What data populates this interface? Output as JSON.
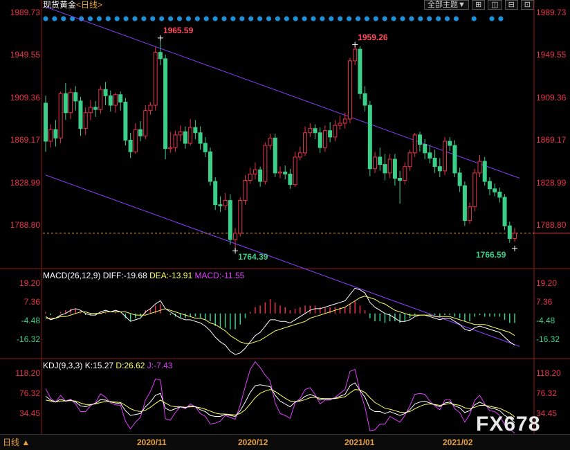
{
  "header": {
    "title": "现货黄金",
    "period_label": "<日线>"
  },
  "toolbar": {
    "theme_label": "全部主题▼",
    "btn1": "⊞",
    "btn2": "◫",
    "btn3": "⊟",
    "btn4": "⊡"
  },
  "price_axis": [
    "1989.73",
    "1949.55",
    "1909.36",
    "1869.17",
    "1828.99",
    "1788.80"
  ],
  "annotations": {
    "high1": "1965.59",
    "low1": "1764.39",
    "high2": "1959.26",
    "low2": "1766.59"
  },
  "macd": {
    "title": "MACD(26,12,9)",
    "diff_label": "DIFF:-19.68",
    "dea_label": "DEA:-13.91",
    "macd_label": "MACD:-11.55",
    "axis": [
      "19.20",
      "7.36",
      "-4.48",
      "-16.32"
    ]
  },
  "kdj": {
    "title": "KDJ(9,3,3)",
    "k_label": "K:15.27",
    "d_label": "D:26.62",
    "j_label": "J:-7.43",
    "axis": [
      "118.20",
      "76.32",
      "34.45"
    ]
  },
  "date_axis": [
    "2020/11",
    "2020/12",
    "2021/01",
    "2021/02"
  ],
  "bottom": {
    "period_button": "日线 ▲"
  },
  "watermark": "FX678",
  "colors": {
    "up": "#e8334a",
    "down": "#3ccf8a",
    "channel": "#8a3cff",
    "diff": "#ffffff",
    "dea": "#ffff66",
    "j": "#e040fb"
  },
  "chart_data": {
    "type": "candlestick",
    "instrument": "现货黄金",
    "y_range": [
      1764.39,
      1989.73
    ],
    "x_ticks": [
      "2020/11",
      "2020/12",
      "2021/01",
      "2021/02"
    ],
    "annotations": [
      {
        "label": "1965.59",
        "value": 1965.59
      },
      {
        "label": "1764.39",
        "value": 1764.39
      },
      {
        "label": "1959.26",
        "value": 1959.26
      },
      {
        "label": "1766.59",
        "value": 1766.59
      }
    ],
    "candles": [
      [
        1904,
        1868,
        1911,
        1858
      ],
      [
        1868,
        1879,
        1884,
        1862
      ],
      [
        1879,
        1871,
        1888,
        1863
      ],
      [
        1871,
        1913,
        1915,
        1866
      ],
      [
        1913,
        1895,
        1923,
        1888
      ],
      [
        1895,
        1914,
        1918,
        1889
      ],
      [
        1914,
        1906,
        1920,
        1897
      ],
      [
        1906,
        1880,
        1910,
        1873
      ],
      [
        1880,
        1895,
        1900,
        1874
      ],
      [
        1895,
        1900,
        1907,
        1888
      ],
      [
        1900,
        1898,
        1906,
        1891
      ],
      [
        1898,
        1917,
        1920,
        1894
      ],
      [
        1917,
        1911,
        1924,
        1902
      ],
      [
        1911,
        1902,
        1916,
        1896
      ],
      [
        1902,
        1912,
        1914,
        1895
      ],
      [
        1912,
        1905,
        1915,
        1897
      ],
      [
        1905,
        1869,
        1909,
        1864
      ],
      [
        1869,
        1858,
        1876,
        1852
      ],
      [
        1858,
        1879,
        1885,
        1856
      ],
      [
        1879,
        1873,
        1887,
        1868
      ],
      [
        1873,
        1897,
        1902,
        1870
      ],
      [
        1897,
        1902,
        1905,
        1893
      ],
      [
        1902,
        1952,
        1957,
        1897
      ],
      [
        1952,
        1946,
        1966,
        1940
      ],
      [
        1946,
        1861,
        1950,
        1851
      ],
      [
        1861,
        1862,
        1877,
        1857
      ],
      [
        1862,
        1874,
        1878,
        1858
      ],
      [
        1874,
        1877,
        1883,
        1868
      ],
      [
        1877,
        1866,
        1882,
        1861
      ],
      [
        1866,
        1881,
        1889,
        1864
      ],
      [
        1881,
        1876,
        1888,
        1870
      ],
      [
        1876,
        1866,
        1882,
        1860
      ],
      [
        1866,
        1858,
        1872,
        1853
      ],
      [
        1858,
        1830,
        1862,
        1826
      ],
      [
        1830,
        1808,
        1834,
        1803
      ],
      [
        1808,
        1807,
        1816,
        1801
      ],
      [
        1807,
        1812,
        1819,
        1803
      ],
      [
        1812,
        1775,
        1818,
        1770
      ],
      [
        1775,
        1781,
        1786,
        1764
      ],
      [
        1781,
        1812,
        1815,
        1778
      ],
      [
        1812,
        1831,
        1836,
        1808
      ],
      [
        1831,
        1837,
        1843,
        1828
      ],
      [
        1837,
        1841,
        1848,
        1832
      ],
      [
        1841,
        1830,
        1844,
        1825
      ],
      [
        1830,
        1864,
        1867,
        1827
      ],
      [
        1864,
        1871,
        1875,
        1860
      ],
      [
        1871,
        1838,
        1875,
        1834
      ],
      [
        1838,
        1839,
        1844,
        1833
      ],
      [
        1839,
        1837,
        1845,
        1832
      ],
      [
        1837,
        1827,
        1842,
        1823
      ],
      [
        1827,
        1853,
        1858,
        1825
      ],
      [
        1853,
        1857,
        1863,
        1850
      ],
      [
        1857,
        1876,
        1882,
        1854
      ],
      [
        1876,
        1880,
        1885,
        1872
      ],
      [
        1880,
        1876,
        1884,
        1870
      ],
      [
        1876,
        1862,
        1881,
        1857
      ],
      [
        1862,
        1878,
        1883,
        1858
      ],
      [
        1878,
        1872,
        1886,
        1867
      ],
      [
        1872,
        1883,
        1888,
        1868
      ],
      [
        1883,
        1885,
        1892,
        1879
      ],
      [
        1885,
        1889,
        1895,
        1880
      ],
      [
        1889,
        1944,
        1947,
        1885
      ],
      [
        1944,
        1955,
        1959,
        1940
      ],
      [
        1955,
        1913,
        1958,
        1908
      ],
      [
        1913,
        1902,
        1920,
        1896
      ],
      [
        1902,
        1842,
        1906,
        1835
      ],
      [
        1842,
        1853,
        1858,
        1838
      ],
      [
        1853,
        1846,
        1862,
        1840
      ],
      [
        1846,
        1838,
        1856,
        1831
      ],
      [
        1838,
        1851,
        1856,
        1833
      ],
      [
        1851,
        1833,
        1856,
        1826
      ],
      [
        1833,
        1831,
        1840,
        1809
      ],
      [
        1831,
        1844,
        1848,
        1827
      ],
      [
        1844,
        1857,
        1860,
        1840
      ],
      [
        1857,
        1874,
        1876,
        1853
      ],
      [
        1874,
        1865,
        1877,
        1858
      ],
      [
        1865,
        1857,
        1870,
        1851
      ],
      [
        1857,
        1852,
        1864,
        1847
      ],
      [
        1852,
        1844,
        1860,
        1838
      ],
      [
        1844,
        1840,
        1852,
        1834
      ],
      [
        1840,
        1868,
        1872,
        1836
      ],
      [
        1868,
        1864,
        1872,
        1859
      ],
      [
        1864,
        1838,
        1869,
        1834
      ],
      [
        1838,
        1826,
        1843,
        1820
      ],
      [
        1826,
        1793,
        1830,
        1788
      ],
      [
        1793,
        1806,
        1810,
        1790
      ],
      [
        1806,
        1838,
        1842,
        1802
      ],
      [
        1838,
        1849,
        1855,
        1834
      ],
      [
        1849,
        1830,
        1853,
        1826
      ],
      [
        1830,
        1823,
        1834,
        1817
      ],
      [
        1823,
        1820,
        1828,
        1816
      ],
      [
        1820,
        1815,
        1824,
        1810
      ],
      [
        1815,
        1788,
        1818,
        1784
      ],
      [
        1788,
        1776,
        1792,
        1772
      ],
      [
        1776,
        1781,
        1786,
        1773
      ]
    ],
    "channel": {
      "upper": [
        [
          0,
          1995
        ],
        [
          95,
          1833
        ]
      ],
      "lower": [
        [
          0,
          1836
        ],
        [
          95,
          1674
        ]
      ]
    },
    "macd": {
      "diff": [
        -2,
        -4,
        -3,
        -1,
        0,
        2,
        3,
        2,
        0,
        -1,
        -1,
        1,
        2,
        1,
        2,
        1,
        -2,
        -5,
        -4,
        -3,
        1,
        3,
        6,
        8,
        3,
        1,
        -1,
        -3,
        -4,
        -4,
        -5,
        -6,
        -8,
        -11,
        -15,
        -18,
        -20,
        -24,
        -26,
        -25,
        -22,
        -18,
        -14,
        -12,
        -8,
        -4,
        -4,
        -5,
        -5,
        -6,
        -4,
        -2,
        0,
        2,
        3,
        3,
        4,
        5,
        6,
        7,
        8,
        12,
        16,
        15,
        13,
        7,
        4,
        2,
        0,
        -1,
        -3,
        -5,
        -5,
        -4,
        -2,
        -1,
        -1,
        -2,
        -3,
        -4,
        -3,
        -3,
        -5,
        -7,
        -10,
        -11,
        -9,
        -8,
        -9,
        -10,
        -11,
        -12,
        -15,
        -18,
        -20
      ],
      "dea": [
        -3,
        -3,
        -3,
        -2,
        -2,
        -1,
        0,
        1,
        1,
        0,
        0,
        0,
        1,
        1,
        1,
        1,
        1,
        0,
        -1,
        -1,
        -1,
        0,
        1,
        2,
        3,
        2,
        1,
        0,
        -1,
        -2,
        -3,
        -3,
        -4,
        -6,
        -7,
        -9,
        -11,
        -14,
        -16,
        -18,
        -19,
        -19,
        -18,
        -17,
        -15,
        -13,
        -11,
        -10,
        -9,
        -8,
        -7,
        -6,
        -5,
        -3,
        -2,
        -1,
        0,
        1,
        2,
        3,
        4,
        6,
        8,
        10,
        11,
        10,
        9,
        7,
        6,
        4,
        2,
        1,
        0,
        -1,
        -1,
        -1,
        -1,
        -1,
        -2,
        -2,
        -2,
        -2,
        -3,
        -4,
        -5,
        -6,
        -7,
        -7,
        -7,
        -8,
        -9,
        -10,
        -11,
        -12,
        -14
      ],
      "hist": [
        1,
        -1,
        0,
        1,
        2,
        3,
        3,
        1,
        -1,
        -1,
        -1,
        1,
        1,
        0,
        1,
        0,
        -3,
        -5,
        -3,
        -2,
        2,
        3,
        5,
        6,
        0,
        -1,
        -2,
        -3,
        -3,
        -2,
        -2,
        -3,
        -4,
        -5,
        -8,
        -9,
        -9,
        -10,
        -10,
        -7,
        -3,
        1,
        4,
        5,
        7,
        9,
        7,
        5,
        4,
        2,
        3,
        4,
        5,
        5,
        5,
        4,
        4,
        4,
        4,
        4,
        4,
        6,
        8,
        5,
        2,
        -3,
        -5,
        -5,
        -6,
        -5,
        -5,
        -6,
        -5,
        -3,
        -1,
        0,
        0,
        -1,
        -1,
        -2,
        -1,
        -1,
        -2,
        -3,
        -5,
        -5,
        -2,
        -1,
        -2,
        -2,
        -2,
        -2,
        -4,
        -6,
        -6
      ]
    },
    "kdj": {
      "k": [
        70,
        62,
        58,
        64,
        60,
        62,
        58,
        50,
        48,
        52,
        55,
        63,
        62,
        58,
        56,
        55,
        40,
        30,
        32,
        34,
        48,
        58,
        72,
        76,
        45,
        40,
        44,
        48,
        46,
        50,
        48,
        42,
        38,
        30,
        28,
        28,
        32,
        30,
        28,
        40,
        58,
        78,
        92,
        94,
        92,
        90,
        72,
        60,
        54,
        48,
        58,
        62,
        70,
        74,
        70,
        62,
        64,
        64,
        66,
        70,
        74,
        92,
        98,
        82,
        68,
        44,
        38,
        38,
        34,
        38,
        34,
        30,
        34,
        42,
        54,
        58,
        60,
        56,
        52,
        48,
        56,
        58,
        50,
        46,
        36,
        40,
        52,
        58,
        52,
        46,
        44,
        40,
        30,
        24,
        15
      ],
      "d": [
        62,
        60,
        58,
        60,
        60,
        61,
        60,
        56,
        53,
        53,
        54,
        57,
        59,
        59,
        58,
        57,
        51,
        44,
        40,
        38,
        41,
        47,
        55,
        62,
        56,
        50,
        48,
        48,
        47,
        48,
        48,
        46,
        43,
        39,
        35,
        33,
        33,
        32,
        31,
        34,
        42,
        54,
        67,
        76,
        81,
        84,
        80,
        73,
        66,
        60,
        59,
        60,
        63,
        67,
        68,
        66,
        65,
        65,
        65,
        67,
        69,
        77,
        84,
        83,
        78,
        67,
        57,
        51,
        45,
        43,
        40,
        37,
        36,
        38,
        44,
        49,
        53,
        54,
        53,
        51,
        53,
        55,
        53,
        51,
        46,
        44,
        47,
        51,
        51,
        49,
        47,
        45,
        40,
        35,
        27
      ],
      "j": [
        86,
        66,
        58,
        72,
        60,
        64,
        54,
        38,
        38,
        50,
        57,
        75,
        68,
        56,
        52,
        51,
        18,
        2,
        16,
        26,
        62,
        80,
        106,
        104,
        23,
        20,
        36,
        48,
        44,
        54,
        48,
        34,
        28,
        12,
        14,
        18,
        30,
        26,
        22,
        52,
        90,
        126,
        142,
        130,
        114,
        102,
        56,
        34,
        30,
        24,
        56,
        66,
        84,
        88,
        74,
        54,
        62,
        62,
        68,
        76,
        84,
        122,
        126,
        80,
        48,
        -2,
        0,
        12,
        12,
        28,
        22,
        16,
        30,
        50,
        74,
        76,
        74,
        60,
        50,
        42,
        62,
        64,
        44,
        36,
        16,
        32,
        62,
        72,
        54,
        40,
        38,
        30,
        10,
        2,
        -7
      ]
    }
  }
}
